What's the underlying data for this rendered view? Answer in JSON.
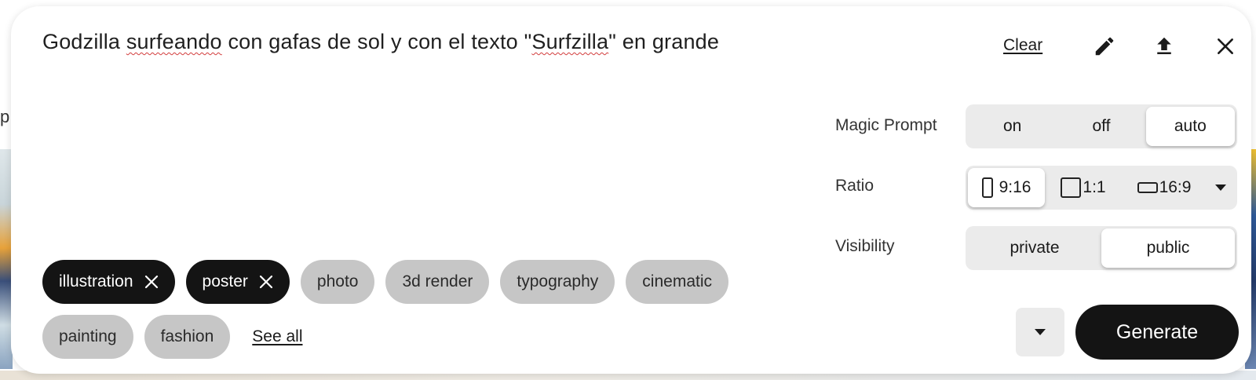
{
  "background": {
    "left_text": "p"
  },
  "prompt": {
    "before1": "Godzilla ",
    "word1": "surfeando",
    "middle": " con gafas de sol y con el texto \"",
    "word2": "Surfzilla",
    "after": "\" en grande"
  },
  "actions": {
    "clear_label": "Clear",
    "edit_icon": "pencil-icon",
    "upload_icon": "upload-icon",
    "close_icon": "close-icon"
  },
  "settings": {
    "magic_prompt": {
      "label": "Magic Prompt",
      "options": [
        "on",
        "off",
        "auto"
      ],
      "selected": "auto"
    },
    "ratio": {
      "label": "Ratio",
      "options": [
        "9:16",
        "1:1",
        "16:9"
      ],
      "selected": "9:16"
    },
    "visibility": {
      "label": "Visibility",
      "options": [
        "private",
        "public"
      ],
      "selected": "public"
    }
  },
  "tags": {
    "selected": [
      "illustration",
      "poster"
    ],
    "available": [
      "photo",
      "3d render",
      "typography",
      "cinematic",
      "painting",
      "fashion"
    ],
    "see_all_label": "See all"
  },
  "generate": {
    "label": "Generate"
  },
  "colors": {
    "chip_selected": "#141414",
    "chip_default": "#c6c6c6",
    "segment_bg": "#ebebeb",
    "generate_bg": "#141414"
  }
}
